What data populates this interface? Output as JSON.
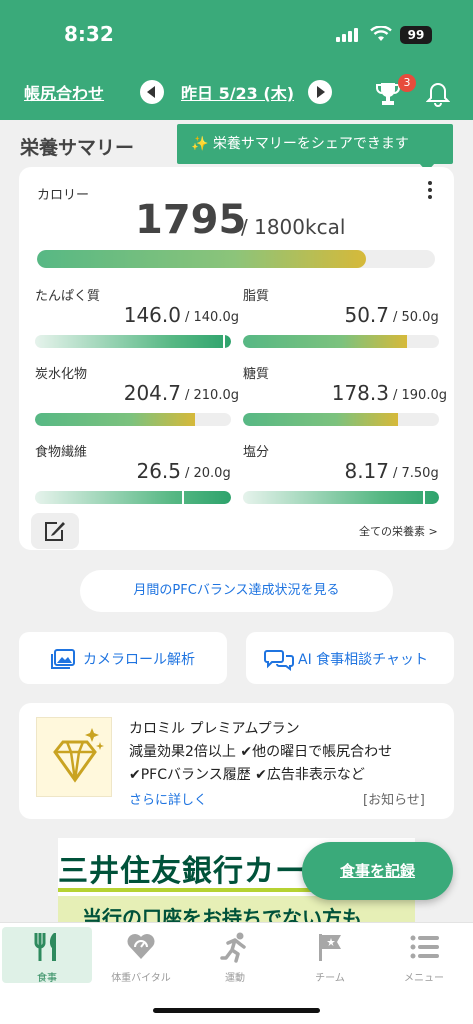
{
  "status_bar": {
    "time": "8:32",
    "battery": "99"
  },
  "header": {
    "ledger_link": "帳尻合わせ",
    "date": "昨日 5/23 (木)",
    "notification_count": "3"
  },
  "summary": {
    "title": "栄養サマリー",
    "share_tip": "✨ 栄養サマリーをシェアできます",
    "calorie_label": "カロリー",
    "calorie_value": "1795",
    "calorie_target": "/ 1800kcal",
    "calorie_progress": 0.997,
    "nutrients": [
      {
        "name": "たんぱく質",
        "value": "146.0",
        "target": "/ 140.0g",
        "progress": 1.04,
        "over": true
      },
      {
        "name": "脂質",
        "value": "50.7",
        "target": "/ 50.0g",
        "progress": 0.97,
        "over": false
      },
      {
        "name": "炭水化物",
        "value": "204.7",
        "target": "/ 210.0g",
        "progress": 0.95,
        "over": false
      },
      {
        "name": "糖質",
        "value": "178.3",
        "target": "/ 190.0g",
        "progress": 0.92,
        "over": false
      },
      {
        "name": "食物繊維",
        "value": "26.5",
        "target": "/ 20.0g",
        "progress": 1.33,
        "over": true
      },
      {
        "name": "塩分",
        "value": "8.17",
        "target": "/ 7.50g",
        "progress": 1.09,
        "over": true
      }
    ],
    "all_nutrients_link": "全ての栄養素 >"
  },
  "pfc_button": "月間のPFCバランス達成状況を見る",
  "actions": {
    "camera_roll": "カメラロール解析",
    "ai_chat": "AI 食事相談チャット"
  },
  "premium": {
    "title": "カロミル プレミアムプラン",
    "line1": "減量効果2倍以上 ✔︎他の曜日で帳尻合わせ",
    "line2": "✔︎PFCバランス履歴 ✔︎広告非表示など",
    "more": "さらに詳しく",
    "note": "[お知らせ]"
  },
  "ad": {
    "title": "三井住友銀行カード",
    "subtitle": "当行の口座をお持ちでない方も"
  },
  "fab_label": "食事を記録",
  "tabs": [
    {
      "label": "食事",
      "icon": "fork-knife-icon"
    },
    {
      "label": "体重バイタル",
      "icon": "heart-scale-icon"
    },
    {
      "label": "運動",
      "icon": "running-icon"
    },
    {
      "label": "チーム",
      "icon": "flag-icon"
    },
    {
      "label": "メニュー",
      "icon": "menu-list-icon"
    }
  ],
  "colors": {
    "brand": "#3aaa7a",
    "link": "#1f74e0",
    "bar_green": "#57b884",
    "bar_yellow": "#d6b93a"
  }
}
